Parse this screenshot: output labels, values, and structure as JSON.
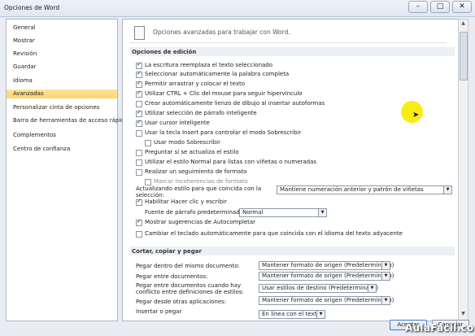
{
  "window": {
    "title": "Opciones de Word",
    "min": "–",
    "max": "□",
    "close": "✕"
  },
  "sidebar": {
    "items": [
      {
        "label": "General"
      },
      {
        "label": "Mostrar"
      },
      {
        "label": "Revisión"
      },
      {
        "label": "Guardar"
      },
      {
        "label": "Idioma"
      },
      {
        "label": "Avanzadas",
        "active": true
      },
      {
        "label": "Personalizar cinta de opciones"
      },
      {
        "label": "Barra de herramientas de acceso rápido"
      },
      {
        "label": "Complementos"
      },
      {
        "label": "Centro de confianza"
      }
    ]
  },
  "header": {
    "text": "Opciones avanzadas para trabajar con Word."
  },
  "edit_section": {
    "title": "Opciones de edición",
    "options": [
      {
        "label": "La escritura reemplaza el texto seleccionado",
        "checked": true
      },
      {
        "label": "Seleccionar automáticamente la palabra completa",
        "checked": true
      },
      {
        "label": "Permitir arrastrar y colocar el texto",
        "checked": true
      },
      {
        "label": "Utilizar CTRL + Clic del mouse para seguir hipervínculo",
        "checked": true
      },
      {
        "label": "Crear automáticamente lienzo de dibujo al insertar autoformas",
        "checked": false
      },
      {
        "label": "Utilizar selección de párrafo inteligente",
        "checked": true
      },
      {
        "label": "Usar cursor inteligente",
        "checked": true
      },
      {
        "label": "Usar la tecla Insert para controlar el modo Sobrescribir",
        "checked": false
      },
      {
        "label": "Usar modo Sobrescribir",
        "checked": false
      },
      {
        "label": "Preguntar si se actualiza el estilo",
        "checked": false
      },
      {
        "label": "Utilizar el estilo Normal para listas con viñetas o numeradas",
        "checked": false
      },
      {
        "label": "Realizar un seguimiento de formato",
        "checked": false
      },
      {
        "label": "Marcar incoherencias de formato",
        "checked": false
      }
    ],
    "style_label": "Actualizando estilo para que coincida con la selección:",
    "style_value": "Mantiene numeración anterior y patrón de viñetas",
    "hyperlink": {
      "label": "Habilitar Hacer clic y escribir",
      "checked": true
    },
    "paragraph_style_label": "Fuente de párrafo predeterminada:",
    "paragraph_style_value": "Normal",
    "autocomplete": {
      "label": "Mostrar sugerencias de Autocompletar",
      "checked": true
    },
    "keyboard": {
      "label": "Cambiar el teclado automáticamente para que coincida con el idioma del texto adyacente",
      "checked": false
    }
  },
  "paste_section": {
    "title": "Cortar, copiar y pegar",
    "rows": [
      {
        "label": "Pegar dentro del mismo documento:",
        "value": "Mantener formato de origen (Predeterminado)"
      },
      {
        "label": "Pegar entre documentos:",
        "value": "Mantener formato de origen (Predeterminado)"
      },
      {
        "label": "Pegar entre documentos cuando hay conflicto entre definiciones de estilos:",
        "value": "Usar estilos de destino (Predeterminado)"
      },
      {
        "label": "Pegar desde otras aplicaciones:",
        "value": "Mantener formato de origen (Predeterminado)"
      },
      {
        "label": "Insertar o pegar",
        "value": "En línea con el texto"
      }
    ]
  },
  "footer": {
    "ok": "Aceptar",
    "cancel": "Cancelar"
  },
  "watermark": "AulaFacil.com",
  "colors": {
    "active_nav": "#fbd76a",
    "cursor_highlight": "#f7ec00"
  }
}
